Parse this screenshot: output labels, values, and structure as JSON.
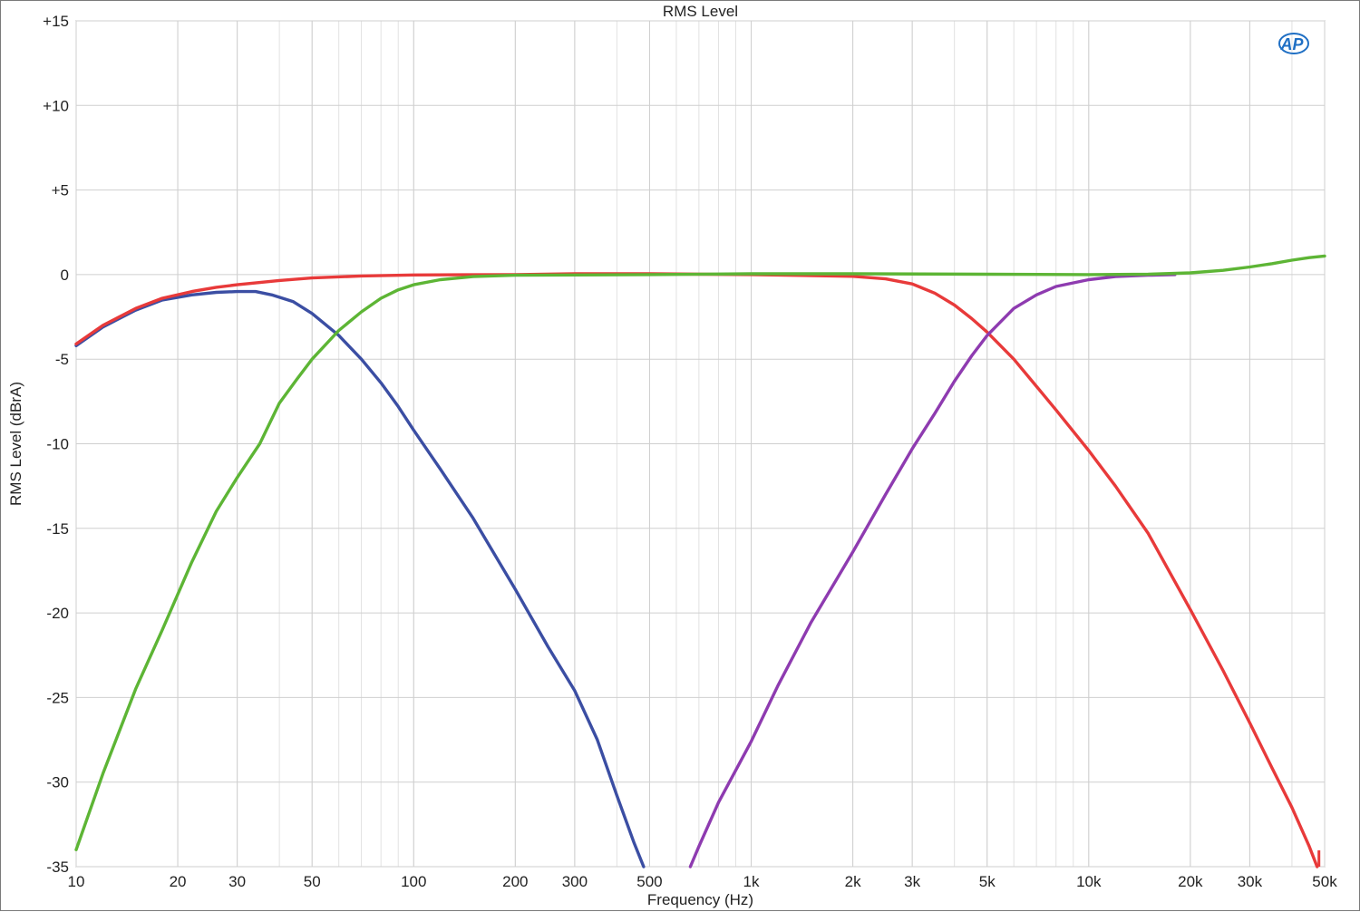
{
  "chart_data": {
    "type": "line",
    "title": "RMS Level",
    "xlabel": "Frequency (Hz)",
    "ylabel": "RMS Level (dBrA)",
    "x_scale": "log",
    "xlim": [
      10,
      50000
    ],
    "ylim": [
      -35,
      15
    ],
    "grid": true,
    "x_ticks": [
      {
        "value": 10,
        "label": "10"
      },
      {
        "value": 20,
        "label": "20"
      },
      {
        "value": 30,
        "label": "30"
      },
      {
        "value": 50,
        "label": "50"
      },
      {
        "value": 100,
        "label": "100"
      },
      {
        "value": 200,
        "label": "200"
      },
      {
        "value": 300,
        "label": "300"
      },
      {
        "value": 500,
        "label": "500"
      },
      {
        "value": 1000,
        "label": "1k"
      },
      {
        "value": 2000,
        "label": "2k"
      },
      {
        "value": 3000,
        "label": "3k"
      },
      {
        "value": 5000,
        "label": "5k"
      },
      {
        "value": 10000,
        "label": "10k"
      },
      {
        "value": 20000,
        "label": "20k"
      },
      {
        "value": 30000,
        "label": "30k"
      },
      {
        "value": 50000,
        "label": "50k"
      }
    ],
    "y_ticks": [
      {
        "value": 15,
        "label": "+15"
      },
      {
        "value": 10,
        "label": "+10"
      },
      {
        "value": 5,
        "label": "+5"
      },
      {
        "value": 0,
        "label": "0"
      },
      {
        "value": -5,
        "label": "-5"
      },
      {
        "value": -10,
        "label": "-10"
      },
      {
        "value": -15,
        "label": "-15"
      },
      {
        "value": -20,
        "label": "-20"
      },
      {
        "value": -25,
        "label": "-25"
      },
      {
        "value": -30,
        "label": "-30"
      },
      {
        "value": -35,
        "label": "-35"
      }
    ],
    "series": [
      {
        "color": "#e83a3a",
        "points": [
          [
            10,
            -4.1
          ],
          [
            12,
            -3.0
          ],
          [
            15,
            -2.0
          ],
          [
            18,
            -1.4
          ],
          [
            22,
            -1.0
          ],
          [
            26,
            -0.75
          ],
          [
            30,
            -0.6
          ],
          [
            40,
            -0.35
          ],
          [
            50,
            -0.2
          ],
          [
            70,
            -0.08
          ],
          [
            100,
            -0.02
          ],
          [
            200,
            0
          ],
          [
            300,
            0.05
          ],
          [
            500,
            0.05
          ],
          [
            1000,
            0
          ],
          [
            2000,
            -0.1
          ],
          [
            2500,
            -0.25
          ],
          [
            3000,
            -0.55
          ],
          [
            3500,
            -1.1
          ],
          [
            4000,
            -1.8
          ],
          [
            4500,
            -2.6
          ],
          [
            5000,
            -3.4
          ],
          [
            6000,
            -5.0
          ],
          [
            7000,
            -6.6
          ],
          [
            8000,
            -8.0
          ],
          [
            10000,
            -10.4
          ],
          [
            12000,
            -12.5
          ],
          [
            15000,
            -15.3
          ],
          [
            20000,
            -19.8
          ],
          [
            25000,
            -23.4
          ],
          [
            30000,
            -26.5
          ],
          [
            35000,
            -29.2
          ],
          [
            40000,
            -31.5
          ],
          [
            45000,
            -33.8
          ],
          [
            47500,
            -35.0
          ]
        ]
      },
      {
        "color": "#3b4ea3",
        "points": [
          [
            10,
            -4.2
          ],
          [
            12,
            -3.1
          ],
          [
            15,
            -2.1
          ],
          [
            18,
            -1.5
          ],
          [
            22,
            -1.2
          ],
          [
            26,
            -1.05
          ],
          [
            30,
            -1.0
          ],
          [
            34,
            -1.0
          ],
          [
            38,
            -1.2
          ],
          [
            44,
            -1.6
          ],
          [
            50,
            -2.3
          ],
          [
            60,
            -3.6
          ],
          [
            70,
            -5.0
          ],
          [
            80,
            -6.4
          ],
          [
            90,
            -7.8
          ],
          [
            100,
            -9.2
          ],
          [
            120,
            -11.5
          ],
          [
            150,
            -14.4
          ],
          [
            200,
            -18.6
          ],
          [
            250,
            -22.0
          ],
          [
            300,
            -24.6
          ],
          [
            350,
            -27.5
          ],
          [
            400,
            -30.8
          ],
          [
            450,
            -33.6
          ],
          [
            480,
            -35.0
          ]
        ]
      },
      {
        "color": "#5db535",
        "points": [
          [
            10,
            -34.0
          ],
          [
            12,
            -29.5
          ],
          [
            15,
            -24.5
          ],
          [
            18,
            -21.0
          ],
          [
            22,
            -17.0
          ],
          [
            26,
            -14.0
          ],
          [
            30,
            -12.0
          ],
          [
            35,
            -10.0
          ],
          [
            40,
            -7.6
          ],
          [
            45,
            -6.2
          ],
          [
            50,
            -5.0
          ],
          [
            60,
            -3.3
          ],
          [
            70,
            -2.2
          ],
          [
            80,
            -1.4
          ],
          [
            90,
            -0.9
          ],
          [
            100,
            -0.6
          ],
          [
            120,
            -0.3
          ],
          [
            150,
            -0.12
          ],
          [
            200,
            -0.04
          ],
          [
            500,
            0
          ],
          [
            1000,
            0.05
          ],
          [
            2000,
            0.05
          ],
          [
            5000,
            0.02
          ],
          [
            10000,
            0
          ],
          [
            15000,
            0.02
          ],
          [
            20000,
            0.1
          ],
          [
            25000,
            0.25
          ],
          [
            30000,
            0.45
          ],
          [
            35000,
            0.65
          ],
          [
            40000,
            0.85
          ],
          [
            45000,
            1.0
          ],
          [
            50000,
            1.1
          ]
        ]
      },
      {
        "color": "#8e3bb0",
        "points": [
          [
            660,
            -35.0
          ],
          [
            700,
            -33.8
          ],
          [
            800,
            -31.2
          ],
          [
            1000,
            -27.6
          ],
          [
            1200,
            -24.3
          ],
          [
            1500,
            -20.6
          ],
          [
            2000,
            -16.4
          ],
          [
            2500,
            -13.0
          ],
          [
            3000,
            -10.3
          ],
          [
            3500,
            -8.2
          ],
          [
            4000,
            -6.3
          ],
          [
            4500,
            -4.8
          ],
          [
            5000,
            -3.6
          ],
          [
            6000,
            -2.0
          ],
          [
            7000,
            -1.2
          ],
          [
            8000,
            -0.7
          ],
          [
            10000,
            -0.3
          ],
          [
            12000,
            -0.12
          ],
          [
            15000,
            -0.04
          ],
          [
            18000,
            0
          ]
        ]
      }
    ],
    "logo": "AP"
  }
}
